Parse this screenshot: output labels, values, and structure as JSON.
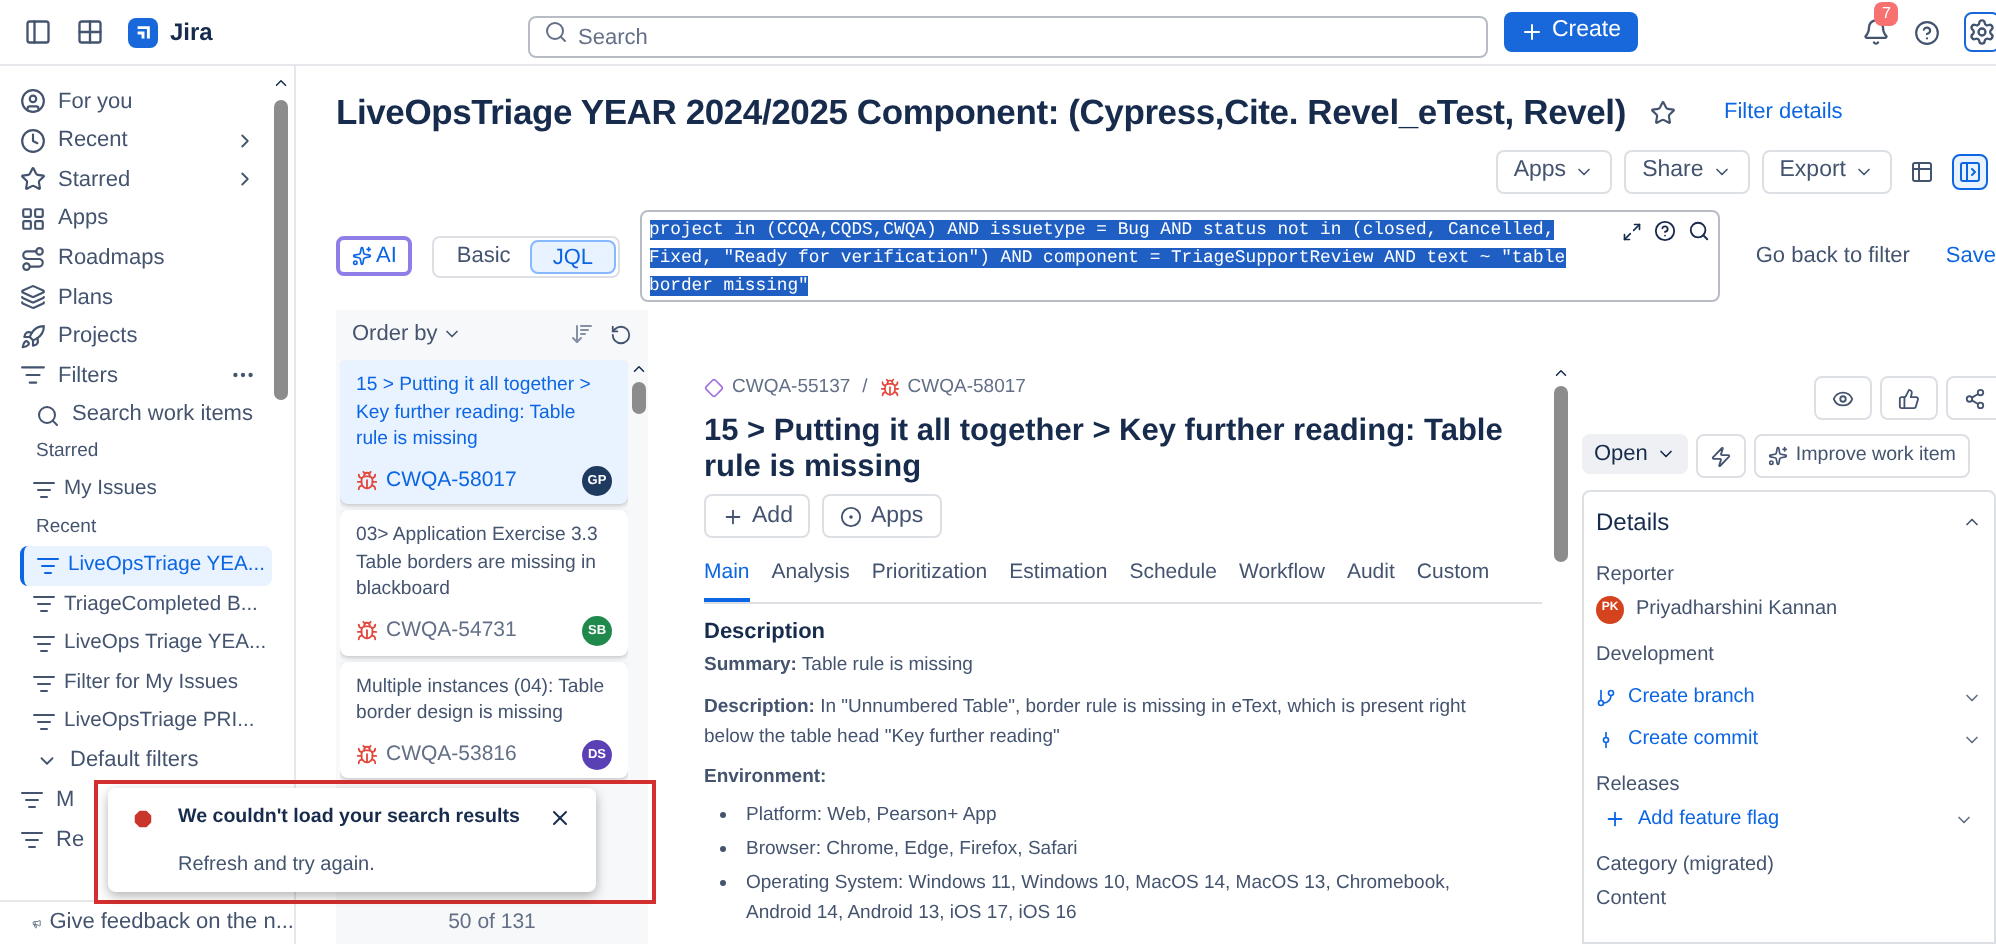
{
  "topbar": {
    "product": "Jira",
    "search_placeholder": "Search",
    "create": "Create",
    "notifications": "7"
  },
  "sidebar": {
    "nav": [
      {
        "label": "For you",
        "kind": "user",
        "arrow": false
      },
      {
        "label": "Recent",
        "kind": "clock",
        "arrow": true
      },
      {
        "label": "Starred",
        "kind": "star",
        "arrow": true
      },
      {
        "label": "Apps",
        "kind": "apps",
        "arrow": false
      },
      {
        "label": "Roadmaps",
        "kind": "roadmap",
        "arrow": false
      },
      {
        "label": "Plans",
        "kind": "plans",
        "arrow": false
      },
      {
        "label": "Projects",
        "kind": "projects",
        "arrow": false
      }
    ],
    "filters": {
      "label": "Filters",
      "search": "Search work items",
      "sections": [
        {
          "heading": "Starred",
          "items": [
            {
              "label": "My Issues",
              "selected": false
            }
          ]
        },
        {
          "heading": "Recent",
          "items": [
            {
              "label": "LiveOpsTriage YEA...",
              "selected": true
            },
            {
              "label": "TriageCompleted B...",
              "selected": false
            },
            {
              "label": "LiveOps Triage YEA...",
              "selected": false
            },
            {
              "label": "Filter for My Issues",
              "selected": false
            },
            {
              "label": "LiveOpsTriage PRI...",
              "selected": false
            }
          ]
        }
      ],
      "default_filters": {
        "label": "Default filters",
        "expanded": true,
        "children": [
          {
            "label": "M"
          },
          {
            "label": "Re"
          }
        ]
      }
    },
    "feedback": "Give feedback on the n..."
  },
  "header": {
    "title": "LiveOpsTriage YEAR 2024/2025 Component: (Cypress,Cite. Revel_eTest, Revel)",
    "starred": false,
    "filter_details": "Filter details",
    "actions": [
      "Apps",
      "Share",
      "Export"
    ],
    "views": [
      {
        "kind": "list",
        "selected": false
      },
      {
        "kind": "detail",
        "selected": true
      }
    ]
  },
  "search_bar": {
    "ai": "AI",
    "modes": [
      {
        "label": "Basic",
        "selected": false
      },
      {
        "label": "JQL",
        "selected": true
      }
    ],
    "jql": "project in (CCQA,CQDS,CWQA) AND issuetype = Bug AND status not in (closed, Cancelled, Fixed, \"Ready for verification\") AND component = TriageSupportReview AND text ~ \"table border missing\"",
    "jql_highlighted": true,
    "go_back": "Go back to filter",
    "save": "Save"
  },
  "results": {
    "order_by": "Order by",
    "count": "50 of 131",
    "items": [
      {
        "title": "15 > Putting it all together > Key further reading: Table rule is missing",
        "key": "CWQA-58017",
        "initials": "GP",
        "color": "#1e3a5f",
        "selected": true
      },
      {
        "title": "03> Application Exercise 3.3 Table borders are missing in blackboard",
        "key": "CWQA-54731",
        "initials": "SB",
        "color": "#1f8a4c",
        "selected": false
      },
      {
        "title": "Multiple instances (04): Table border design is missing",
        "key": "CWQA-53816",
        "initials": "DS",
        "color": "#5b3fb5",
        "selected": false
      }
    ]
  },
  "issue": {
    "parent_key": "CWQA-55137",
    "separator": "/",
    "key": "CWQA-58017",
    "title": "15 > Putting it all together > Key further reading: Table rule is missing",
    "buttons": [
      "Add",
      "Apps"
    ],
    "tabs": [
      {
        "label": "Main",
        "selected": true
      },
      {
        "label": "Analysis",
        "selected": false
      },
      {
        "label": "Prioritization",
        "selected": false
      },
      {
        "label": "Estimation",
        "selected": false
      },
      {
        "label": "Schedule",
        "selected": false
      },
      {
        "label": "Workflow",
        "selected": false
      },
      {
        "label": "Audit",
        "selected": false
      },
      {
        "label": "Custom",
        "selected": false
      }
    ],
    "description_heading": "Description",
    "paragraphs": [
      "**Summary:** Table rule is missing",
      "**Description:** In \"Unnumbered Table\", border rule is missing in eText, which is present right below the table head \"Key further reading\""
    ],
    "environment_heading": "Environment:",
    "environment": [
      "Platform: Web, Pearson+ App",
      "Browser: Chrome, Edge, Firefox, Safari",
      "Operating System: Windows 11, Windows 10, MacOS 14, MacOS 13, Chromebook, Android 14, Android 13, iOS 17, iOS 16"
    ]
  },
  "side": {
    "status": "Open",
    "improve": "Improve work item",
    "details": "Details",
    "details_expanded": true,
    "reporter_label": "Reporter",
    "reporter": {
      "name": "Priyadharshini Kannan",
      "initials": "PK"
    },
    "development_label": "Development",
    "dev_links": [
      {
        "label": "Create branch",
        "kind": "branch"
      },
      {
        "label": "Create commit",
        "kind": "commit"
      }
    ],
    "releases_label": "Releases",
    "release_link": "Add feature flag",
    "category_label": "Category (migrated)",
    "category": "Content"
  },
  "toast": {
    "title": "We couldn't load your search results",
    "body": "Refresh and try again.",
    "highlighted": true
  }
}
